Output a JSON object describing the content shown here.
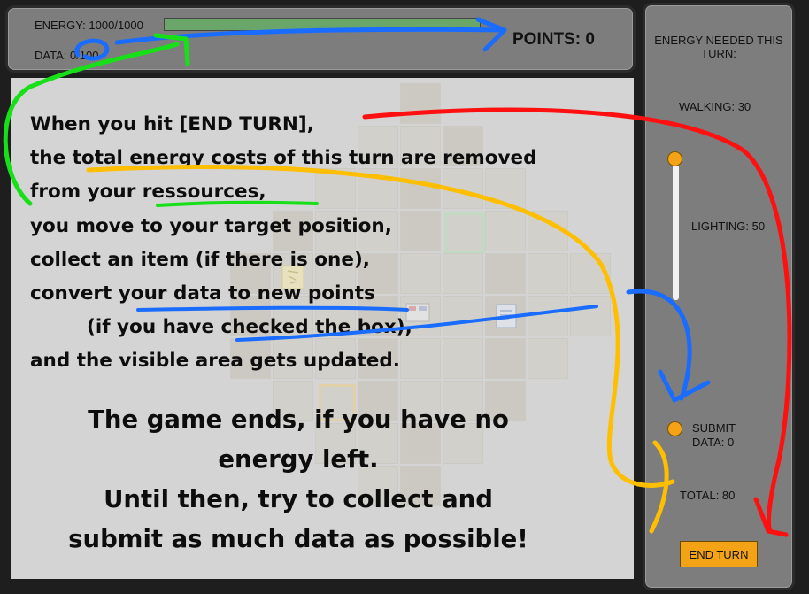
{
  "top_bar": {
    "energy_label": "ENERGY: 1000/1000",
    "energy_fraction": 1.0,
    "data_label": "DATA: 0/100",
    "points_label": "POINTS: 0"
  },
  "instructions": {
    "lines": [
      "When you hit [END TURN],",
      "the total energy costs of this turn are removed",
      "from your ressources,",
      "you move to your target position,",
      "collect an item (if there is one),",
      "convert your data to new points",
      "(if you have checked the box),",
      "and the visible area gets updated."
    ],
    "ending_lines": [
      "The game ends, if you have no",
      "energy left.",
      "Until then, try to collect and",
      "submit as much data as possible!"
    ]
  },
  "side_panel": {
    "heading": "ENERGY NEEDED THIS TURN:",
    "walking_label": "WALKING: 30",
    "lighting_label": "LIGHTING: 50",
    "submit_label_line1": "SUBMIT",
    "submit_label_line2": "DATA: 0",
    "total_label": "TOTAL: 80",
    "end_turn_label": "END TURN"
  },
  "colors": {
    "panel": "#7d7d7d",
    "accent_orange": "#f5a316",
    "energy_bar": "#6aa66a",
    "annotation_blue": "#1a6cff",
    "annotation_green": "#18e018",
    "annotation_red": "#ff1010",
    "annotation_yellow": "#ffbe00"
  }
}
